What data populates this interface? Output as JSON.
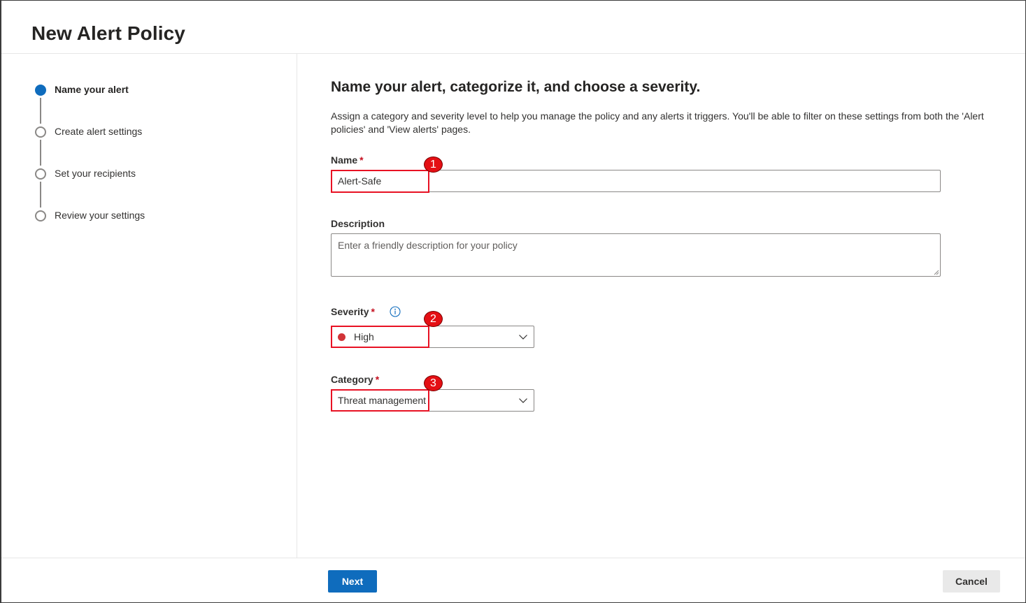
{
  "page": {
    "title": "New Alert Policy"
  },
  "stepper": {
    "steps": [
      {
        "label": "Name your alert",
        "state": "active"
      },
      {
        "label": "Create alert settings",
        "state": "pending"
      },
      {
        "label": "Set your recipients",
        "state": "pending"
      },
      {
        "label": "Review your settings",
        "state": "pending"
      }
    ]
  },
  "main": {
    "heading": "Name your alert, categorize it, and choose a severity.",
    "description": "Assign a category and severity level to help you manage the policy and any alerts it triggers. You'll be able to filter on these settings from both the 'Alert policies' and 'View alerts' pages.",
    "name_field": {
      "label": "Name",
      "required_mark": "*",
      "value": "Alert-Safe"
    },
    "description_field": {
      "label": "Description",
      "placeholder": "Enter a friendly description for your policy"
    },
    "severity_field": {
      "label": "Severity",
      "required_mark": "*",
      "selected": "High",
      "indicator_color": "#d13438",
      "info_icon": "info-icon"
    },
    "category_field": {
      "label": "Category",
      "required_mark": "*",
      "selected": "Threat management"
    }
  },
  "annotations": {
    "badges": [
      "1",
      "2",
      "3"
    ],
    "color": "#e81123"
  },
  "footer": {
    "next_label": "Next",
    "cancel_label": "Cancel"
  },
  "colors": {
    "accent": "#0f6cbd",
    "required": "#c50f1f"
  }
}
